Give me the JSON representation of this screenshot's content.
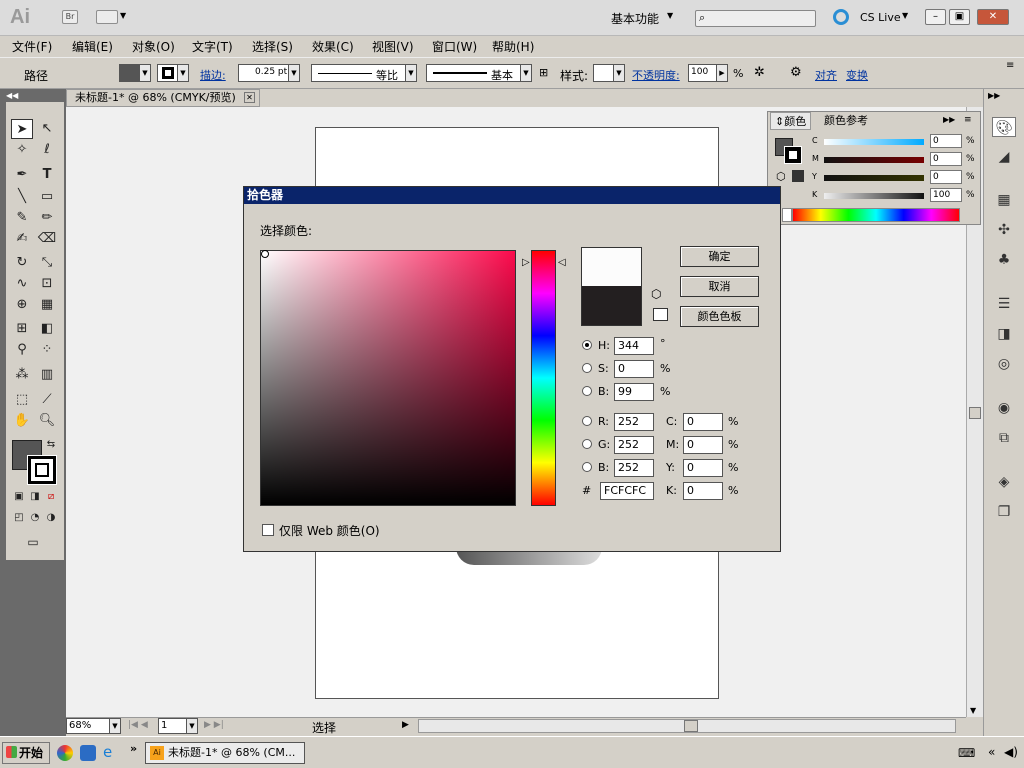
{
  "title_bar": {
    "app_logo": "Ai",
    "bridge_label": "Br",
    "workspace": "基本功能",
    "search_placeholder": "",
    "cs_live": "CS Live"
  },
  "menu": [
    "文件(F)",
    "编辑(E)",
    "对象(O)",
    "文字(T)",
    "选择(S)",
    "效果(C)",
    "视图(V)",
    "窗口(W)",
    "帮助(H)"
  ],
  "control_bar": {
    "object_type": "路径",
    "stroke_label": "描边:",
    "stroke_weight": "0.25 pt",
    "profile_label": "等比",
    "brush_label": "基本",
    "style_label": "样式:",
    "opacity_label": "不透明度:",
    "opacity_value": "100",
    "opacity_unit": "%",
    "align_label": "对齐",
    "transform_label": "变换"
  },
  "document_tab": {
    "title": "未标题-1* @ 68% (CMYK/预览)"
  },
  "status_bar": {
    "zoom": "68%",
    "page": "1",
    "tool_status": "选择"
  },
  "color_panel": {
    "tabs": [
      "颜色",
      "颜色参考"
    ],
    "sliders": [
      {
        "label": "C",
        "value": "0",
        "unit": "%"
      },
      {
        "label": "M",
        "value": "0",
        "unit": "%"
      },
      {
        "label": "Y",
        "value": "0",
        "unit": "%"
      },
      {
        "label": "K",
        "value": "100",
        "unit": "%"
      }
    ]
  },
  "color_picker": {
    "title": "拾色器",
    "select_label": "选择颜色:",
    "ok": "确定",
    "cancel": "取消",
    "swatches": "颜色色板",
    "hsb": [
      {
        "label": "H:",
        "value": "344",
        "unit": "°"
      },
      {
        "label": "S:",
        "value": "0",
        "unit": "%"
      },
      {
        "label": "B:",
        "value": "99",
        "unit": "%"
      }
    ],
    "rgb": [
      {
        "label": "R:",
        "value": "252"
      },
      {
        "label": "G:",
        "value": "252"
      },
      {
        "label": "B:",
        "value": "252"
      }
    ],
    "cmyk": [
      {
        "label": "C:",
        "value": "0",
        "unit": "%"
      },
      {
        "label": "M:",
        "value": "0",
        "unit": "%"
      },
      {
        "label": "Y:",
        "value": "0",
        "unit": "%"
      },
      {
        "label": "K:",
        "value": "0",
        "unit": "%"
      }
    ],
    "hex_label": "#",
    "hex": "FCFCFC",
    "web_only": "仅限 Web 颜色(O)",
    "new_color": "#fcfcfc",
    "old_color": "#231f20"
  },
  "taskbar": {
    "start": "开始",
    "task": "未标题-1* @ 68% (CM..."
  }
}
